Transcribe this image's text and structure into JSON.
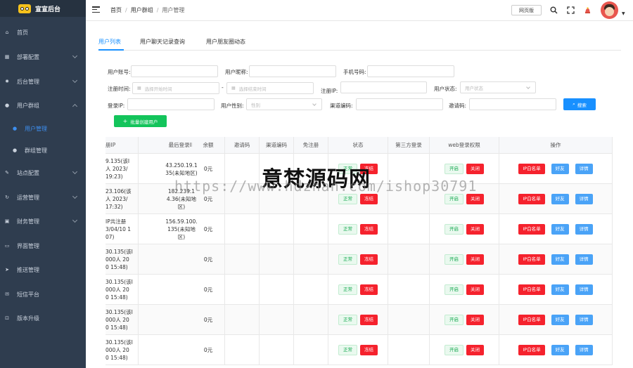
{
  "app": {
    "title": "宣宣后台"
  },
  "sidebar": {
    "items": [
      {
        "label": "首页",
        "icon": "home-icon",
        "glyph": "⌂"
      },
      {
        "label": "部署配置",
        "icon": "grid-icon",
        "glyph": "▦"
      },
      {
        "label": "后台管理",
        "icon": "gear-icon",
        "glyph": "✹"
      },
      {
        "label": "用户群组",
        "icon": "user-icon",
        "glyph": "●"
      },
      {
        "label": "用户管理",
        "icon": "user-icon",
        "glyph": "●"
      },
      {
        "label": "群组管理",
        "icon": "group-icon",
        "glyph": "●"
      },
      {
        "label": "站点配置",
        "icon": "wrench-icon",
        "glyph": "✎"
      },
      {
        "label": "运营管理",
        "icon": "refresh-icon",
        "glyph": "↻"
      },
      {
        "label": "财务管理",
        "icon": "wallet-icon",
        "glyph": "▣"
      },
      {
        "label": "界面管理",
        "icon": "monitor-icon",
        "glyph": "▭"
      },
      {
        "label": "推送管理",
        "icon": "send-icon",
        "glyph": "➤"
      },
      {
        "label": "短信平台",
        "icon": "message-icon",
        "glyph": "✉"
      },
      {
        "label": "版本升级",
        "icon": "upgrade-icon",
        "glyph": "⊡"
      }
    ]
  },
  "header": {
    "breadcrumb": [
      "首页",
      "用户群组",
      "用户管理"
    ],
    "web_button": "网页版",
    "icons": [
      "search-icon",
      "fullscreen-icon",
      "bell-icon"
    ]
  },
  "tabs": [
    "用户列表",
    "用户聊天记录查询",
    "用户朋友圈动态"
  ],
  "filters": {
    "account_label": "用户账号:",
    "nickname_label": "用户昵称:",
    "phone_label": "手机号码:",
    "reg_time_label": "注册时间:",
    "start_placeholder": "选择开始时间",
    "range_sep": "-",
    "end_placeholder": "选择结束时间",
    "reg_ip_label": "注册IP:",
    "status_label": "用户状态:",
    "status_placeholder": "用户状态",
    "login_ip_label": "登录IP:",
    "gender_label": "用户性别:",
    "gender_placeholder": "性别",
    "channel_label": "渠道编码:",
    "invite_label": "邀请码:",
    "search_button": "搜索",
    "batch_button": "批量创建用户"
  },
  "table": {
    "headers": [
      "册IP",
      "最后登录IP",
      "余额",
      "邀请码",
      "渠道编码",
      "免注册",
      "状态",
      "第三方登录",
      "web登录权限",
      "操作"
    ],
    "rows": [
      {
        "reg_ip": [
          "9.135(该I",
          "人 2023/",
          "19:23)"
        ],
        "last_ip": [
          "43.250.19.1",
          "35(未知地区)"
        ],
        "balance": "0元"
      },
      {
        "reg_ip": [
          "23.106(该",
          "人 2023/",
          "17:32)"
        ],
        "last_ip": [
          "182.239.1",
          "4.36(未知地",
          "区)"
        ],
        "balance": "0元"
      },
      {
        "reg_ip": [
          "IP共注册",
          "3/04/10 1",
          "07)"
        ],
        "last_ip": [
          "156.59.100.",
          "135(未知地",
          "区)"
        ],
        "balance": "0元"
      },
      {
        "reg_ip": [
          "30.135(该I",
          "000人 20",
          "0 15:48)"
        ],
        "last_ip": [],
        "balance": "0元"
      },
      {
        "reg_ip": [
          "30.135(该I",
          "000人 20",
          "0 15:48)"
        ],
        "last_ip": [],
        "balance": "0元"
      },
      {
        "reg_ip": [
          "30.135(该I",
          "000人 20",
          "0 15:48)"
        ],
        "last_ip": [],
        "balance": "0元"
      },
      {
        "reg_ip": [
          "30.135(该I",
          "000人 20",
          "0 15:48)"
        ],
        "last_ip": [],
        "balance": "0元"
      }
    ],
    "status_normal": "正常",
    "freeze": "冻结",
    "web_on": "开启",
    "web_off": "关闭",
    "op_whitelist": "IP白名单",
    "op_friend": "好友",
    "op_detail": "详情"
  },
  "watermark": {
    "title": "意梵源码网",
    "url": "https://www.hdzhan.com/ishop30791"
  }
}
